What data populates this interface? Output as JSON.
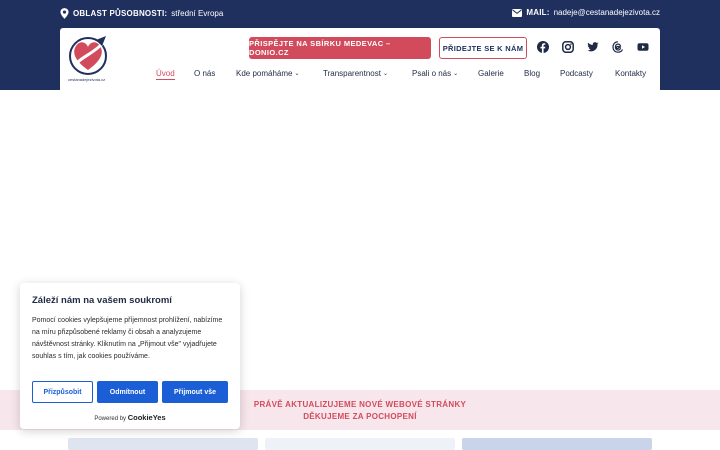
{
  "topbar": {
    "area_label": "OBLAST PŮSOBNOSTI:",
    "area_value": "střední Evropa",
    "mail_label": "MAIL:",
    "mail_value": "nadeje@cestanadejezivota.cz"
  },
  "logo": {
    "caption": "cestanadejezivota.cz"
  },
  "buttons": {
    "donate": "PŘISPĚJTE NA SBÍRKU MEDEVAC – DONIO.CZ",
    "join": "PŘIDEJTE SE K NÁM"
  },
  "social": [
    "facebook-icon",
    "instagram-icon",
    "twitter-icon",
    "threads-icon",
    "youtube-icon"
  ],
  "nav": [
    {
      "label": "Úvod",
      "active": true
    },
    {
      "label": "O nás"
    },
    {
      "label": "Kde pomáháme",
      "dropdown": true
    },
    {
      "label": "Transparentnost",
      "dropdown": true
    },
    {
      "label": "Psali o nás",
      "dropdown": true
    },
    {
      "label": "Galerie"
    },
    {
      "label": "Blog"
    },
    {
      "label": "Podcasty"
    },
    {
      "label": "Kontakty"
    }
  ],
  "notice": {
    "line1": "PRÁVĚ AKTUALIZUJEME NOVÉ WEBOVÉ STRÁNKY",
    "line2": "DĚKUJEME ZA POCHOPENÍ"
  },
  "cookie": {
    "title": "Záleží nám na vašem soukromí",
    "text": "Pomocí cookies vylepšujeme příjemnost prohlížení, nabízíme na míru přizpůsobené reklamy či obsah a analyzujeme návštěvnost stránky. Kliknutím na „Přijmout vše\" vyjadřujete souhlas s tím, jak cookies používáme.",
    "customize": "Přizpůsobit",
    "reject": "Odmítnout",
    "accept": "Přijmout vše",
    "powered_by": "Powered by",
    "brand": "CookieYes"
  },
  "colors": {
    "navy": "#1f2f5e",
    "accent": "#d24b5d",
    "cookie_blue": "#1b5ed6"
  }
}
